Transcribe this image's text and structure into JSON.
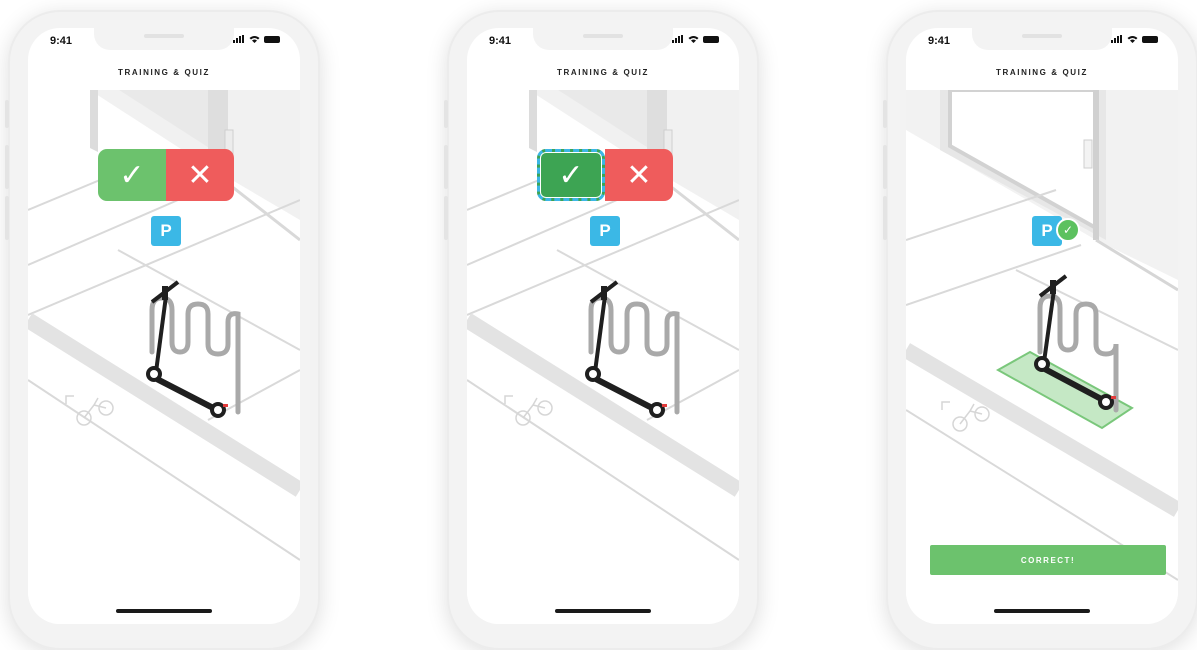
{
  "colors": {
    "accept_green": "#6cc26d",
    "accept_green_selected": "#3da453",
    "reject_red": "#ef5c5c",
    "parking_blue": "#3bb8e6",
    "selection_dash": "#3cb6e6"
  },
  "screens": [
    {
      "status": {
        "time": "9:41"
      },
      "header": {
        "title": "TRAINING & QUIZ"
      },
      "quiz": {
        "accept_icon": "checkmark-icon",
        "reject_icon": "x-icon",
        "accept_glyph": "✓",
        "reject_glyph": "✕",
        "selected": "none"
      },
      "parking": {
        "label": "P"
      }
    },
    {
      "status": {
        "time": "9:41"
      },
      "header": {
        "title": "TRAINING & QUIZ"
      },
      "quiz": {
        "accept_icon": "checkmark-icon",
        "reject_icon": "x-icon",
        "accept_glyph": "✓",
        "reject_glyph": "✕",
        "selected": "accept"
      },
      "parking": {
        "label": "P"
      }
    },
    {
      "status": {
        "time": "9:41"
      },
      "header": {
        "title": "TRAINING & QUIZ"
      },
      "parking": {
        "label": "P",
        "check_glyph": "✓"
      },
      "result": {
        "button_label": "CORRECT!"
      }
    }
  ]
}
